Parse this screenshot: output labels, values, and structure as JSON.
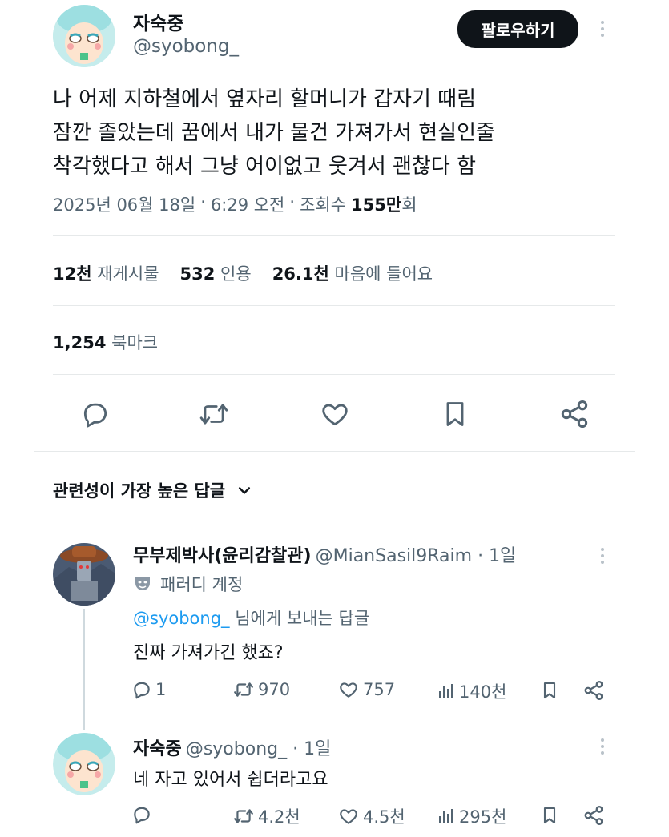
{
  "tweet": {
    "author_name": "자숙중",
    "author_handle": "@syobong_",
    "follow_label": "팔로우하기",
    "text_lines": [
      "나 어제 지하철에서 옆자리 할머니가 갑자기 때림",
      "잠깐 졸았는데 꿈에서 내가 물건 가져가서 현실인줄",
      "착각했다고 해서 그냥 어이없고 웃겨서 괜찮다 함"
    ],
    "meta": {
      "date": "2025년 06월 18일",
      "sep1": "·",
      "time": "6:29 오전",
      "sep2": "·",
      "views_label": "조회수",
      "views_count": "155만",
      "views_suffix": "회"
    },
    "stats": {
      "retweets_count": "12천",
      "retweets_label": "재게시물",
      "quotes_count": "532",
      "quotes_label": "인용",
      "likes_count": "26.1천",
      "likes_label": "마음에 들어요",
      "bookmarks_count": "1,254",
      "bookmarks_label": "북마크"
    },
    "icons": [
      "reply-icon",
      "retweet-icon",
      "like-icon",
      "bookmark-icon",
      "share-icon"
    ]
  },
  "replies_section": {
    "sort_label": "관련성이 가장 높은 답글"
  },
  "replies": [
    {
      "name": "무부제박사(윤리감찰관)",
      "handle_time": "@MianSasil9Raim · 1일",
      "parody_label": "패러디 계정",
      "replying_to_handle": "@syobong_",
      "replying_to_suffix": "님에게 보내는 답글",
      "text": "진짜 가져가긴 했죠?",
      "reply_count": "1",
      "retweet_count": "970",
      "like_count": "757",
      "view_count": "140천"
    },
    {
      "name": "자숙중",
      "handle_time": "@syobong_ · 1일",
      "text": "네 자고 있어서 쉽더라고요",
      "reply_count": "",
      "retweet_count": "4.2천",
      "like_count": "4.5천",
      "view_count": "295천"
    }
  ],
  "colors": {
    "text": "#0f1419",
    "muted": "#536471",
    "link": "#1d9bf0",
    "divider": "#e6e9ea",
    "follow_bg": "#0f1419"
  }
}
